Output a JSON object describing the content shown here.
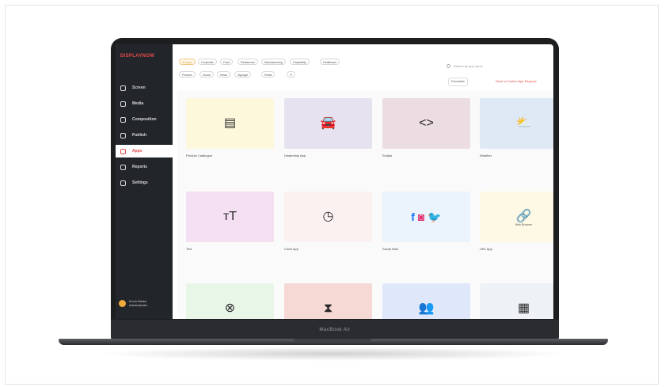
{
  "sidebar": {
    "logo": "DISPLAYNOW",
    "items": [
      {
        "label": "Screen",
        "icon": "monitor-icon"
      },
      {
        "label": "Media",
        "icon": "media-icon"
      },
      {
        "label": "Composition",
        "icon": "composition-icon"
      },
      {
        "label": "Publish",
        "icon": "publish-icon"
      },
      {
        "label": "Apps",
        "icon": "apps-icon"
      },
      {
        "label": "Reports",
        "icon": "reports-icon"
      },
      {
        "label": "Settings",
        "icon": "settings-icon"
      }
    ],
    "active_index": 4,
    "user": {
      "name": "Kevin Bristol",
      "role": "Administrator"
    }
  },
  "filters": {
    "row1": [
      "All Apps",
      "Corporate",
      "Food",
      "Restaurant",
      "Manufacturing",
      "Hospitality",
      "Healthcare"
    ],
    "row2": [
      "Finance",
      "Social",
      "News",
      "Signage",
      "Retail",
      "IT"
    ],
    "active": "All Apps"
  },
  "search": {
    "placeholder": "Search by app name"
  },
  "favorites_label": "Favourites",
  "request_link": "Send a Custom App Request",
  "cards": [
    {
      "title": "Product Catalogue",
      "icon": "catalogue-icon",
      "glyph": "▤",
      "bg": "#fdf8dc"
    },
    {
      "title": "Dealership App",
      "icon": "car-icon",
      "glyph": "🚘",
      "bg": "#e7e2ef"
    },
    {
      "title": "Scripts",
      "icon": "code-icon",
      "glyph": "<>",
      "bg": "#ecdde3"
    },
    {
      "title": "Weather",
      "icon": "weather-icon",
      "glyph": "⛅",
      "bg": "#dfe9f6"
    },
    {
      "title": "Text",
      "icon": "text-icon",
      "glyph": "тT",
      "bg": "#f5dff3"
    },
    {
      "title": "Clock App",
      "icon": "clock-icon",
      "glyph": "◷",
      "bg": "#fbf1f1"
    },
    {
      "title": "Social Wall",
      "icon": "social-icons",
      "glyph": "",
      "bg": "#ebf3fd",
      "social": [
        "f",
        "◙",
        "🐦"
      ]
    },
    {
      "title": "URL App",
      "icon": "link-icon",
      "glyph": "🔗",
      "sub": "Web Browser",
      "bg": "#fdf9e5"
    },
    {
      "title": "",
      "icon": "timer-icon",
      "glyph": "⊗",
      "bg": "#e8f6e8"
    },
    {
      "title": "",
      "icon": "hourglass-icon",
      "glyph": "⧗",
      "bg": "#f6d9d4"
    },
    {
      "title": "",
      "icon": "people-icon",
      "glyph": "👥",
      "bg": "#dfe8fa"
    },
    {
      "title": "",
      "icon": "qr-icon",
      "glyph": "▦",
      "bg": "#eef2f7"
    }
  ],
  "device_label": "MacBook Air"
}
